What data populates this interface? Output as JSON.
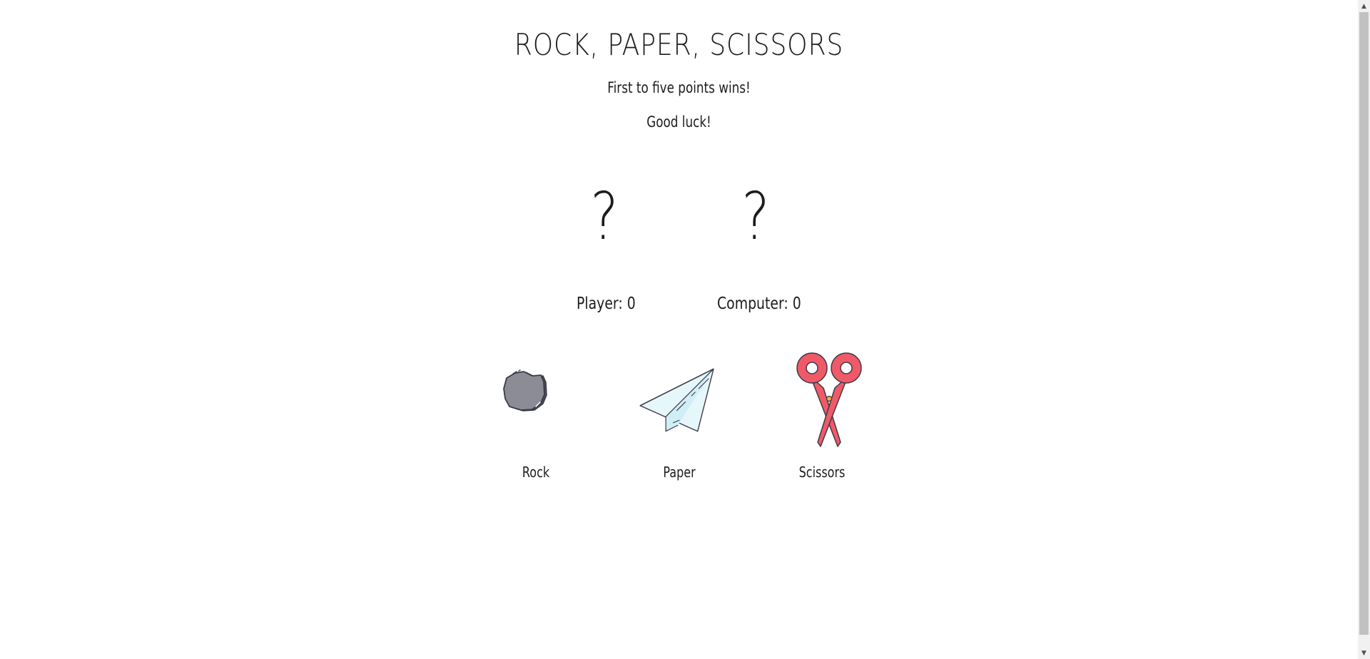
{
  "header": {
    "title": "ROCK, PAPER, SCISSORS",
    "subtitle": "First to five points wins!",
    "tagline": "Good luck!"
  },
  "hands": {
    "player": "?",
    "computer": "?"
  },
  "scores": {
    "player_label": "Player: 0",
    "computer_label": "Computer: 0",
    "player": 0,
    "computer": 0
  },
  "choices": [
    {
      "label": "Rock",
      "icon": "rock-icon",
      "color": "#8c8c96"
    },
    {
      "label": "Paper",
      "icon": "paper-plane-icon",
      "color": "#e6f7fb"
    },
    {
      "label": "Scissors",
      "icon": "scissors-icon",
      "color": "#f05a68"
    }
  ]
}
